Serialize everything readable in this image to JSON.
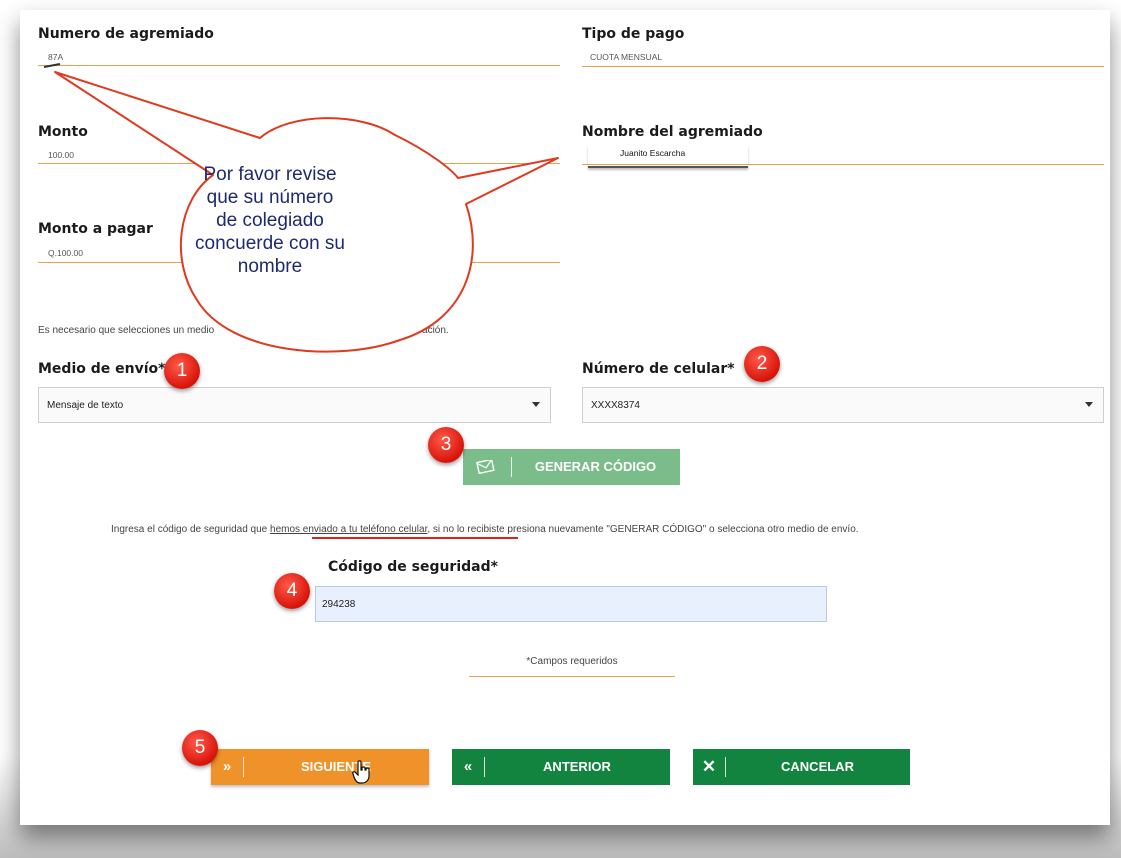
{
  "form": {
    "agremiado_number": {
      "label": "Numero de agremiado",
      "value": "87A"
    },
    "payment_type": {
      "label": "Tipo de pago",
      "value": "CUOTA MENSUAL"
    },
    "amount": {
      "label": "Monto",
      "value": "100.00"
    },
    "member_name": {
      "label": "Nombre del agremiado",
      "value": "Juanito Escarcha"
    },
    "amount_to_pay": {
      "label": "Monto a pagar",
      "value": "Q.100.00"
    }
  },
  "callout": {
    "text": "Por favor revise que su número de colegiado concuerde con su nombre"
  },
  "info_text_left": "Es necesario que selecciones un medio",
  "info_text_right": "operación.",
  "delivery": {
    "label": "Medio de envío*",
    "value": "Mensaje de texto"
  },
  "cellphone": {
    "label": "Número de celular*",
    "value": "XXXX8374"
  },
  "generate_button": {
    "label": "GENERAR CÓDIGO"
  },
  "instruction": {
    "before": "Ingresa el código de seguridad que ",
    "highlight": "hemos enviado a tu teléfono celular",
    "after": ", si no lo recibiste presiona nuevamente \"GENERAR CÓDIGO\" o selecciona otro medio de envío."
  },
  "security_code": {
    "label": "Código de seguridad*",
    "value": "294238"
  },
  "required_note": "*Campos requeridos",
  "buttons": {
    "next": "SIGUIENTE",
    "previous": "ANTERIOR",
    "cancel": "CANCELAR"
  },
  "step_badges": [
    "1",
    "2",
    "3",
    "4",
    "5"
  ],
  "colors": {
    "orange": "#f0922a",
    "green": "#13843f",
    "green_light": "#7bbd8a",
    "badge_red": "#e0241a",
    "callout_stroke": "#e03a1e",
    "callout_text": "#1e2a6e"
  },
  "icons": {
    "next": "double-chevron-right-icon",
    "previous": "double-chevron-left-icon",
    "cancel": "close-icon",
    "generate": "envelope-icon"
  }
}
